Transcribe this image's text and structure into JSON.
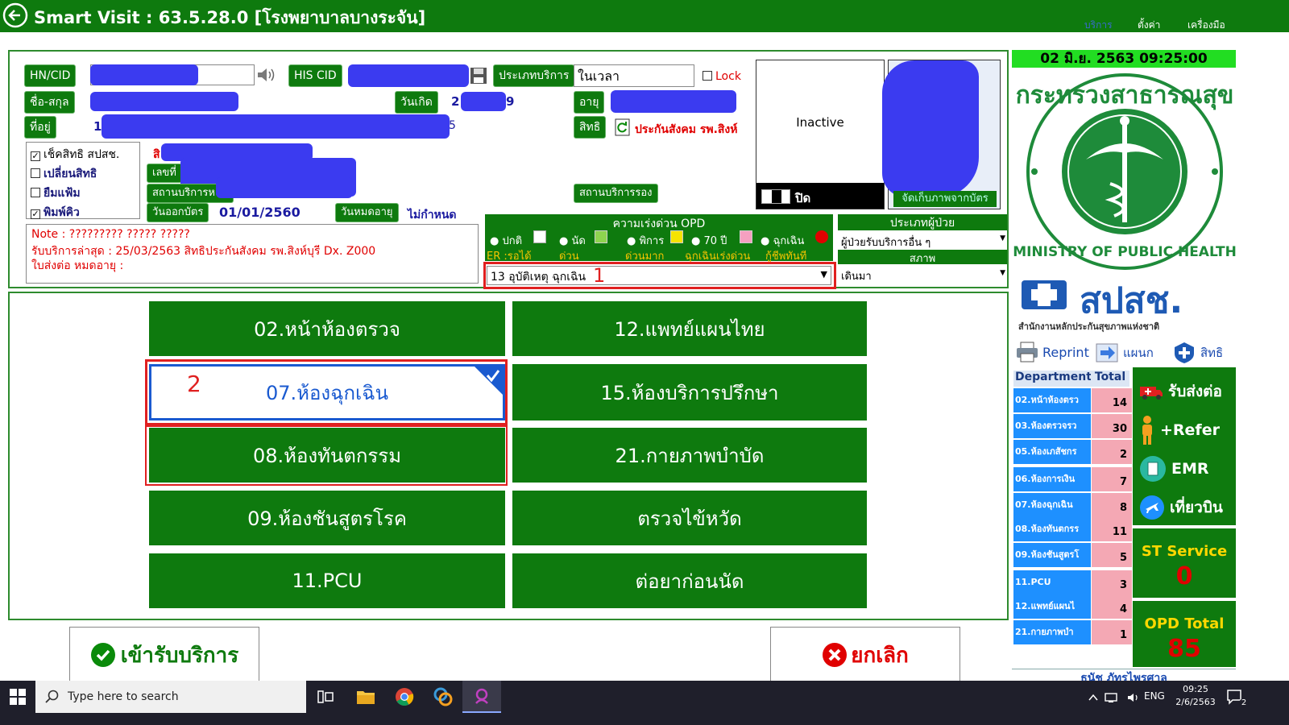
{
  "app": {
    "title": "Smart Visit : 63.5.28.0 [โรงพยาบาลบางระจัน]",
    "menu": [
      "บริการ",
      "ตั้งค่า",
      "เครื่องมือ"
    ]
  },
  "patient": {
    "hn_label": "HN/CID",
    "his_cid_label": "HIS CID",
    "service_type_label": "ประเภทบริการ",
    "service_type_value": "ในเวลา",
    "lock_label": "Lock",
    "name_label": "ชื่อ-สกุล",
    "birth_label": "วันเกิด",
    "birth_value": "2",
    "birth_value2": "9",
    "age_label": "อายุ",
    "address_label": "ที่อยู่",
    "address_value": "1",
    "address_value2": "5",
    "rights_label": "สิทธิ",
    "rights_value": "ประกันสังคม รพ.สิงห์",
    "photo_status": "Inactive",
    "photo_toggle": "ปิด",
    "store_photo_label": "จัดเก็บภาพจากบัตร"
  },
  "checks": [
    {
      "label": "เช็คสิทธิ สปสช.",
      "checked": true
    },
    {
      "label": "เปลี่ยนสิทธิ",
      "checked": false
    },
    {
      "label": "ยืมแฟ้ม",
      "checked": false
    },
    {
      "label": "พิมพ์คิว",
      "checked": true
    }
  ],
  "card": {
    "number_label": "เลขที่",
    "main_station_label": "สถานบริการหลัก",
    "sub_station_label": "สถานบริการรอง",
    "issue_label": "วันออกบัตร",
    "issue_value": "01/01/2560",
    "expire_label": "วันหมดอายุ",
    "expire_value": "ไม่กำหนด",
    "red_initial": "สิ"
  },
  "note": {
    "line1": "Note : ????????? ????? ?????",
    "line2": "รับบริการล่าสุด : 25/03/2563 สิทธิประกันสังคม รพ.สิงห์บุรี Dx. Z000",
    "line3": "ใบส่งต่อ หมดอายุ :"
  },
  "urgency": {
    "title": "ความเร่งด่วน OPD",
    "options": [
      "ปกติ",
      "นัด",
      "พิการ",
      "70 ปี",
      "ฉุกเฉิน"
    ],
    "sublabels": [
      "ER :รอได้",
      "ด่วน",
      "ด่วนมาก",
      "ฉุกเฉินเร่งด่วน",
      "กู้ชีพทันที"
    ],
    "dropdown_value": "13 อุบัติเหตุ ฉุกเฉิน",
    "dropdown_marker": "1"
  },
  "patient_type": {
    "title": "ประเภทผู้ป่วย",
    "value": "ผู้ป่วยรับบริการอื่น ๆ",
    "status_title": "สภาพ",
    "status_value": "เดินมา"
  },
  "services": [
    {
      "label": "02.หน้าห้องตรวจ",
      "selected": false
    },
    {
      "label": "12.แพทย์แผนไทย",
      "selected": false
    },
    {
      "label": "07.ห้องฉุกเฉิน",
      "selected": true
    },
    {
      "label": "15.ห้องบริการปรึกษา",
      "selected": false
    },
    {
      "label": "08.ห้องทันตกรรม",
      "selected": false
    },
    {
      "label": "21.กายภาพบำบัด",
      "selected": false
    },
    {
      "label": "09.ห้องชันสูตรโรค",
      "selected": false
    },
    {
      "label": "ตรวจไข้หวัด",
      "selected": false
    },
    {
      "label": "11.PCU",
      "selected": false
    },
    {
      "label": "ต่อยาก่อนนัด",
      "selected": false
    }
  ],
  "selected_marker": "2",
  "actions": {
    "accept": "เข้ารับบริการ",
    "cancel": "ยกเลิก"
  },
  "right": {
    "datetime": "02 มิ.ย. 2563  09:25:00",
    "logo_text_top": "กระทรวงสาธารณสุข",
    "logo_text_bottom": "MINISTRY OF PUBLIC HEALTH",
    "nhso_text": "สปสช.",
    "nhso_subtitle": "สำนักงานหลักประกันสุขภาพแห่งชาติ",
    "reprint": "Reprint",
    "plan": "แผนก",
    "rights": "สิทธิ",
    "dept_header": "Department",
    "total_header": "Total",
    "departments": [
      {
        "name": "02.หน้าห้องตรว",
        "total": "14"
      },
      {
        "name": "03.ห้องตรวจรว",
        "total": "30"
      },
      {
        "name": "05.ห้องเภสัชกร",
        "total": "2"
      },
      {
        "name": "06.ห้องการเงิน",
        "total": "7"
      },
      {
        "name": "07.ห้องฉุกเฉิน",
        "total": "8"
      },
      {
        "name": "08.ห้องทันตกรร",
        "total": "11"
      },
      {
        "name": "09.ห้องชันสูตรโ",
        "total": "5"
      },
      {
        "name": "11.PCU",
        "total": "3"
      },
      {
        "name": "12.แพทย์แผนไ",
        "total": "4"
      },
      {
        "name": "21.กายภาพบำ",
        "total": "1"
      }
    ],
    "refer_in": "รับส่งต่อ",
    "refer_out": "+Refer",
    "emr": "EMR",
    "travel": "เที่ยวบิน",
    "st_service_label": "ST Service",
    "st_service_value": "0",
    "opd_total_label": "OPD Total",
    "opd_total_value": "85",
    "footer_text": "ธนัช  ภัทรไพรศาล"
  },
  "taskbar": {
    "search_placeholder": "Type here to search",
    "lang": "ENG",
    "time": "09:25",
    "date": "2/6/2563",
    "notif_count": "2"
  }
}
